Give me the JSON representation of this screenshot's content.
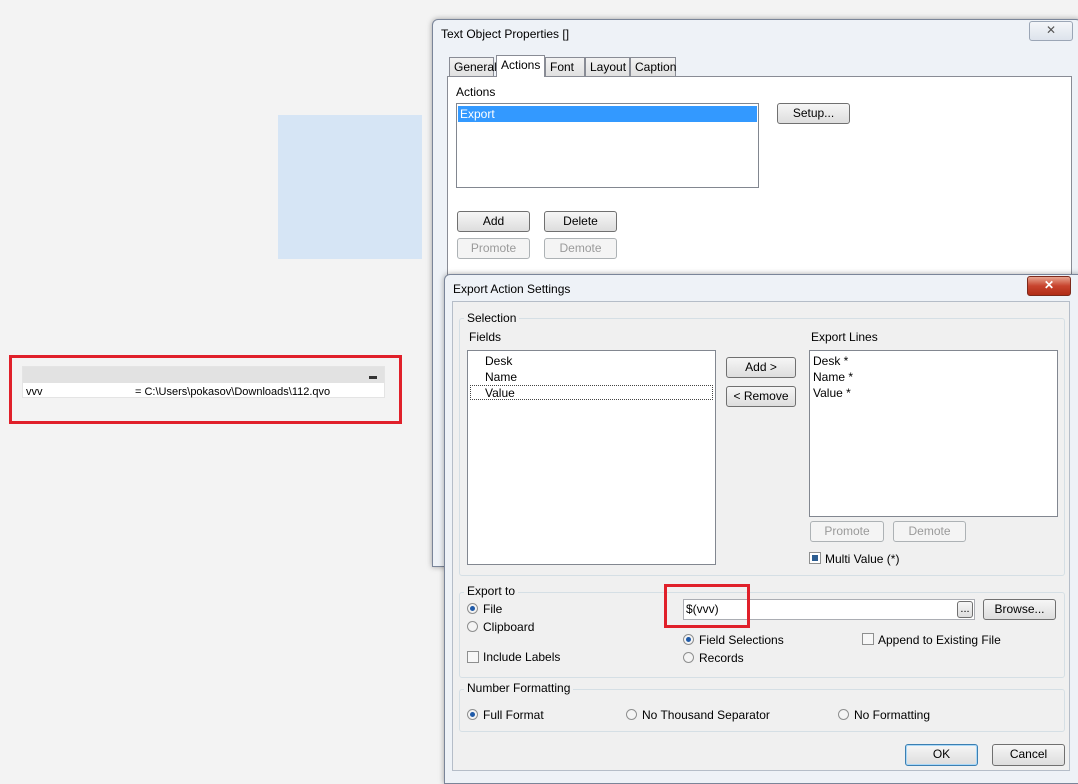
{
  "variable_box": {
    "name": "vvv",
    "value": "= C:\\Users\\pokasov\\Downloads\\112.qvo"
  },
  "tp_window": {
    "title": "Text Object Properties []",
    "close": "✕",
    "tabs": [
      "General",
      "Actions",
      "Font",
      "Layout",
      "Caption"
    ],
    "actions_label": "Actions",
    "actions_list": [
      "Export"
    ],
    "setup": "Setup...",
    "add": "Add",
    "delete": "Delete",
    "promote": "Promote",
    "demote": "Demote"
  },
  "ea_dialog": {
    "title": "Export Action Settings",
    "close": "✕",
    "selection_label": "Selection",
    "fields_label": "Fields",
    "fields": [
      "Desk",
      "Name",
      "Value"
    ],
    "add_btn": "Add >",
    "remove_btn": "< Remove",
    "export_lines_label": "Export Lines",
    "export_lines": [
      "Desk *",
      "Name *",
      "Value *"
    ],
    "promote": "Promote",
    "demote": "Demote",
    "multi_value": "Multi Value (*)",
    "export_to_label": "Export to",
    "file_radio": "File",
    "clipboard_radio": "Clipboard",
    "include_labels": "Include Labels",
    "file_path": "$(vvv)",
    "ellipsis": "...",
    "browse": "Browse...",
    "field_selections": "Field Selections",
    "records": "Records",
    "append": "Append to Existing File",
    "number_formatting_label": "Number Formatting",
    "full_format": "Full Format",
    "no_thousand": "No Thousand Separator",
    "no_formatting": "No Formatting",
    "ok": "OK",
    "cancel": "Cancel"
  },
  "colors": {
    "highlight_red": "#e0202a",
    "selection_blue": "#3399ff"
  }
}
